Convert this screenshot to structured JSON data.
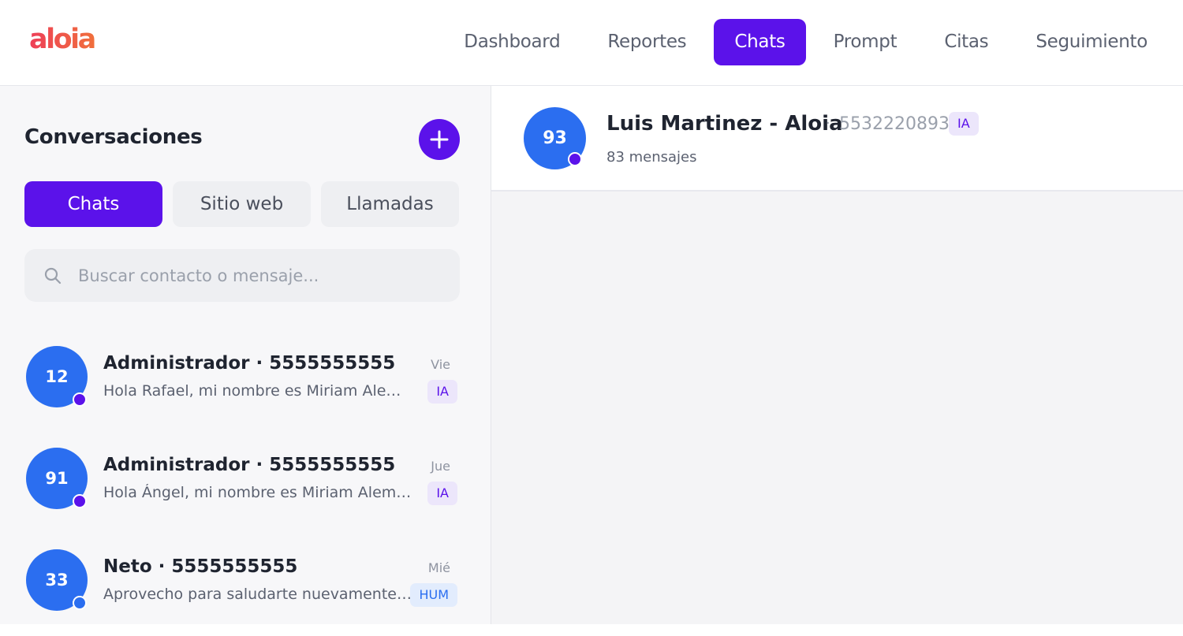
{
  "app": {
    "logo": "aloia"
  },
  "nav": {
    "items": [
      "Dashboard",
      "Reportes",
      "Chats",
      "Prompt",
      "Citas",
      "Seguimiento"
    ],
    "active": "Chats"
  },
  "sidebar": {
    "title": "Conversaciones",
    "add_icon": "plus-icon",
    "tabs": [
      "Chats",
      "Sitio web",
      "Llamadas"
    ],
    "active_tab": "Chats",
    "search": {
      "placeholder": "Buscar contacto o mensaje...",
      "value": "",
      "icon": "search-icon"
    },
    "conversations": [
      {
        "avatar": "12",
        "name": "Administrador · 5555555555",
        "preview": "Hola Rafael, mi nombre es Miriam Aleman, de Aloia. Te escribo para darte seguimiento.",
        "time": "Vie",
        "badge": "IA"
      },
      {
        "avatar": "91",
        "name": "Administrador · 5555555555",
        "preview": "Hola Ángel, mi nombre es Miriam Aleman, de Aloia. Te escribo para darte seguimiento.",
        "time": "Jue",
        "badge": "IA"
      },
      {
        "avatar": "33",
        "name": "Neto · 5555555555",
        "preview": "Aprovecho para saludarte nuevamente, espero que estés muy bien.",
        "time": "Mié",
        "badge": "HUM"
      }
    ]
  },
  "chat": {
    "avatar": "93",
    "name": "Luis Martinez - Aloia",
    "separator": "·",
    "phone": "5532220893",
    "badge": "IA",
    "count": "83 mensajes"
  },
  "colors": {
    "accent": "#5b12ea",
    "avatar": "#2b6ef0",
    "logo_start": "#ee3f58",
    "logo_end": "#f06f3c"
  }
}
